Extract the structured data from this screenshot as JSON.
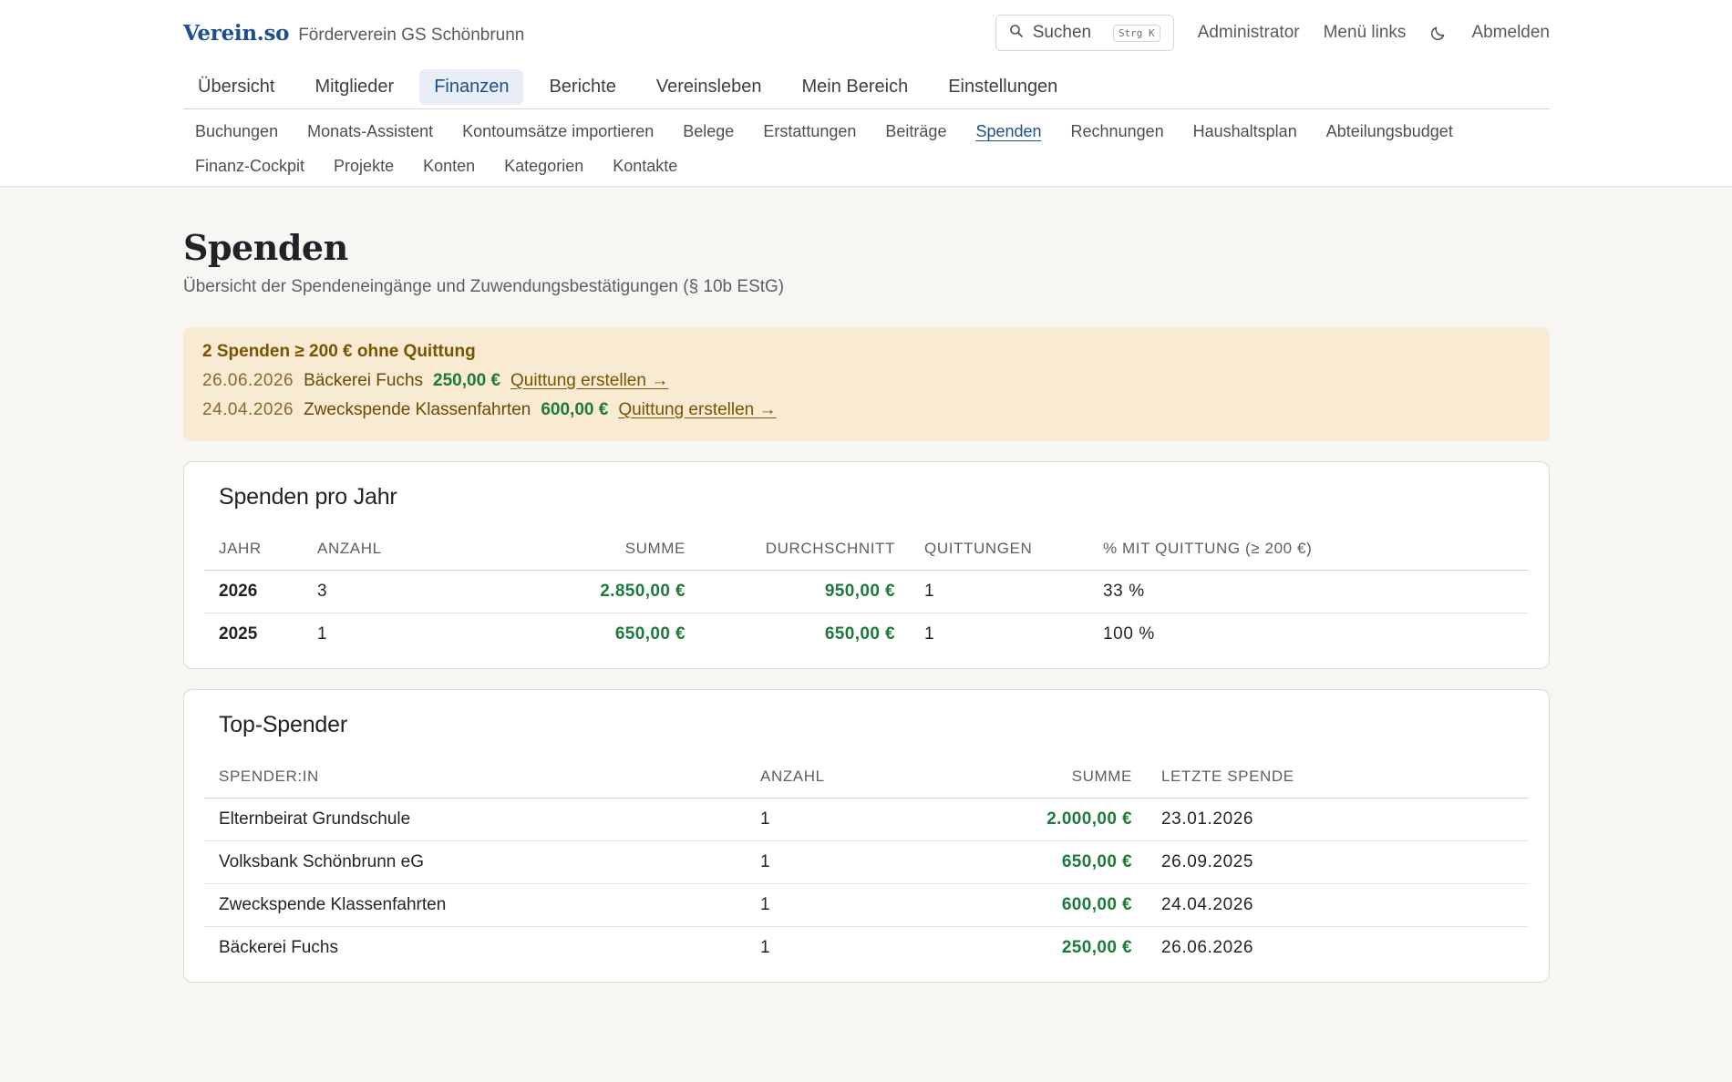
{
  "app": {
    "logo": "Verein.so",
    "org_name": "Förderverein GS Schönbrunn"
  },
  "topbar": {
    "search_label": "Suchen",
    "search_shortcut": "Strg K",
    "admin_label": "Administrator",
    "menu_label": "Menü links",
    "logout_label": "Abmelden"
  },
  "main_nav": [
    "Übersicht",
    "Mitglieder",
    "Finanzen",
    "Berichte",
    "Vereinsleben",
    "Mein Bereich",
    "Einstellungen"
  ],
  "main_nav_active": "Finanzen",
  "sub_nav": [
    "Buchungen",
    "Monats-Assistent",
    "Kontoumsätze importieren",
    "Belege",
    "Erstattungen",
    "Beiträge",
    "Spenden",
    "Rechnungen",
    "Haushaltsplan",
    "Abteilungsbudget",
    "Finanz-Cockpit",
    "Projekte",
    "Konten",
    "Kategorien",
    "Kontakte"
  ],
  "sub_nav_active": "Spenden",
  "page": {
    "title": "Spenden",
    "subtitle": "Übersicht der Spendeneingänge und Zuwendungsbestätigungen (§ 10b EStG)"
  },
  "alert": {
    "title": "2 Spenden ≥ 200 € ohne Quittung",
    "rows": [
      {
        "date": "26.06.2026",
        "name": "Bäckerei Fuchs",
        "amount": "250,00 €",
        "link": "Quittung erstellen →"
      },
      {
        "date": "24.04.2026",
        "name": "Zweckspende Klassenfahrten",
        "amount": "600,00 €",
        "link": "Quittung erstellen →"
      }
    ]
  },
  "per_year": {
    "title": "Spenden pro Jahr",
    "headers": [
      "Jahr",
      "Anzahl",
      "Summe",
      "Durchschnitt",
      "Quittungen",
      "% mit Quittung (≥ 200 €)"
    ],
    "rows": [
      {
        "year": "2026",
        "count": "3",
        "sum": "2.850,00 €",
        "avg": "950,00 €",
        "receipts": "1",
        "pct": "33 %"
      },
      {
        "year": "2025",
        "count": "1",
        "sum": "650,00 €",
        "avg": "650,00 €",
        "receipts": "1",
        "pct": "100 %"
      }
    ]
  },
  "top_donors": {
    "title": "Top-Spender",
    "headers": [
      "Spender:in",
      "Anzahl",
      "Summe",
      "Letzte Spende"
    ],
    "rows": [
      {
        "name": "Elternbeirat Grundschule",
        "count": "1",
        "sum": "2.000,00 €",
        "last": "23.01.2026"
      },
      {
        "name": "Volksbank Schönbrunn eG",
        "count": "1",
        "sum": "650,00 €",
        "last": "26.09.2025"
      },
      {
        "name": "Zweckspende Klassenfahrten",
        "count": "1",
        "sum": "600,00 €",
        "last": "24.04.2026"
      },
      {
        "name": "Bäckerei Fuchs",
        "count": "1",
        "sum": "250,00 €",
        "last": "26.06.2026"
      }
    ]
  },
  "colors": {
    "brand": "#1d4e8f",
    "money": "#1d7a3c",
    "alert_bg": "#f8ead3",
    "alert_text": "#7a5300"
  },
  "icons": {
    "search": "search-icon",
    "theme": "moon-icon"
  }
}
